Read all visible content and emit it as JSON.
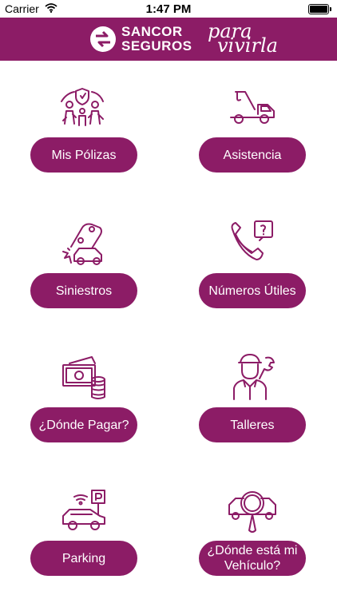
{
  "status_bar": {
    "carrier": "Carrier",
    "time": "1:47 PM"
  },
  "header": {
    "brand_line1": "SANCOR",
    "brand_line2": "SEGUROS",
    "tagline_line1": "para",
    "tagline_line2": "vivirla"
  },
  "menu": {
    "mis_polizas": "Mis Pólizas",
    "asistencia": "Asistencia",
    "siniestros": "Siniestros",
    "numeros_utiles": "Números Útiles",
    "donde_pagar": "¿Dónde Pagar?",
    "talleres": "Talleres",
    "parking": "Parking",
    "donde_vehiculo": "¿Dónde está mi Vehículo?"
  },
  "icons": {
    "mis_polizas": "family-shield-icon",
    "asistencia": "tow-truck-icon",
    "siniestros": "car-crash-icon",
    "numeros_utiles": "phone-question-icon",
    "donde_pagar": "money-coins-icon",
    "talleres": "mechanic-icon",
    "parking": "parking-car-icon",
    "donde_vehiculo": "car-search-icon"
  },
  "colors": {
    "brand": "#8c1c66",
    "background": "#ffffff",
    "text_on_brand": "#ffffff"
  }
}
